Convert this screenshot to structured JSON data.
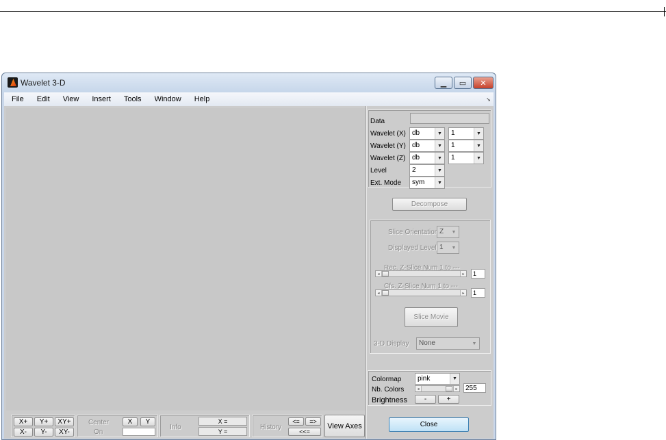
{
  "window": {
    "title": "Wavelet 3-D"
  },
  "menu": {
    "items": [
      "File",
      "Edit",
      "View",
      "Insert",
      "Tools",
      "Window",
      "Help"
    ]
  },
  "params": {
    "data_label": "Data",
    "data_value": "",
    "wavelet_x_label": "Wavelet (X)",
    "wavelet_x_family": "db",
    "wavelet_x_number": "1",
    "wavelet_y_label": "Wavelet (Y)",
    "wavelet_y_family": "db",
    "wavelet_y_number": "1",
    "wavelet_z_label": "Wavelet (Z)",
    "wavelet_z_family": "db",
    "wavelet_z_number": "1",
    "level_label": "Level",
    "level_value": "2",
    "ext_mode_label": "Ext. Mode",
    "ext_mode_value": "sym"
  },
  "decompose_label": "Decompose",
  "slice": {
    "orientation_label": "Slice Orientation",
    "orientation_value": "Z",
    "displayed_level_label": "Displayed Level",
    "displayed_level_value": "1",
    "rec_label": "Rec.  Z-Slice Num 1 to ---",
    "rec_value": "1",
    "cfs_label": "Cfs.  Z-Slice Num 1 to ---",
    "cfs_value": "1",
    "movie_label": "Slice Movie",
    "display3d_label": "3-D Display",
    "display3d_value": "None"
  },
  "colormap": {
    "label": "Colormap",
    "value": "pink",
    "nb_colors_label": "Nb. Colors",
    "nb_colors_value": "255",
    "brightness_label": "Brightness",
    "minus": "-",
    "plus": "+"
  },
  "close_label": "Close",
  "axes_tools": {
    "xplus": "X+",
    "yplus": "Y+",
    "xyplus": "XY+",
    "xminus": "X-",
    "yminus": "Y-",
    "xyminus": "XY-",
    "center_label": "Center",
    "on_label": "On",
    "x_btn": "X",
    "y_btn": "Y",
    "info_label": "Info",
    "x_eq": "X =",
    "y_eq": "Y =",
    "history_label": "History",
    "back": "<=",
    "forward": "=>",
    "reset": "<<=",
    "view_axes": "View Axes"
  }
}
